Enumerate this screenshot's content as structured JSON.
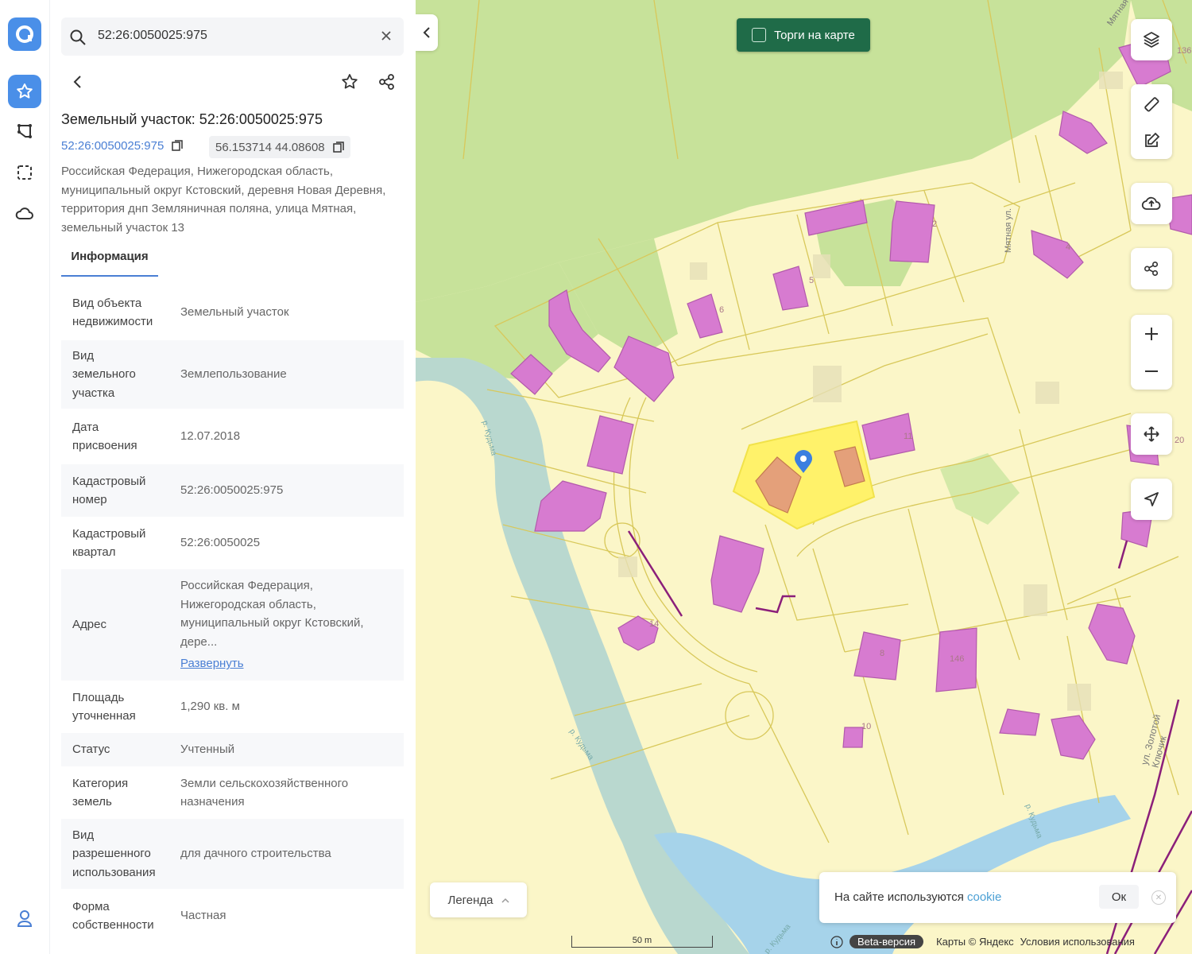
{
  "search": {
    "query": "52:26:0050025:975"
  },
  "panel": {
    "title": "Земельный участок: 52:26:0050025:975",
    "cadastral_link": "52:26:0050025:975",
    "coordinates": "56.153714 44.08608",
    "address": "Российская Федерация, Нижегородская область, муниципальный округ Кстовский, деревня Новая Деревня, территория днп Земляничная поляна, улица Мятная, земельный участок 13",
    "tab_info": "Информация",
    "rows": [
      {
        "label": "Вид объекта недвижимости",
        "value": "Земельный участок"
      },
      {
        "label": "Вид земельного участка",
        "value": "Землепользование"
      },
      {
        "label": "Дата присвоения",
        "value": "12.07.2018"
      },
      {
        "label": "Кадастровый номер",
        "value": "52:26:0050025:975"
      },
      {
        "label": "Кадастровый квартал",
        "value": "52:26:0050025"
      },
      {
        "label": "Адрес",
        "value": "Российская Федерация, Нижегородская область, муниципальный округ Кстовский, дере...",
        "expand": "Развернуть"
      },
      {
        "label": "Площадь уточненная",
        "value": "1,290 кв. м"
      },
      {
        "label": "Статус",
        "value": "Учтенный"
      },
      {
        "label": "Категория земель",
        "value": "Земли сельскохозяйственного назначения"
      },
      {
        "label": "Вид разрешенного использования",
        "value": "для дачного строительства"
      },
      {
        "label": "Форма собственности",
        "value": "Частная"
      }
    ]
  },
  "map": {
    "torgi_label": "Торги на карте",
    "legend_label": "Легенда",
    "cookie_text": "На сайте используются",
    "cookie_link": "cookie",
    "cookie_ok": "Ок",
    "scale_label": "50 m",
    "footer": {
      "beta": "Beta-версия",
      "maps_credit": "Карты © Яндекс",
      "terms": "Условия использования"
    },
    "labels": {
      "street_myatnaya_1": "Мятная ул.",
      "street_myatnaya_2": "Мятная ул.",
      "street_zolotoy": "ул. Золотой Ключик",
      "river_1": "р. Кудьма",
      "river_2": "р. Кудьма",
      "river_3": "р. Кудьма",
      "river_4": "р. Кудьма",
      "n2": "2",
      "n5": "5",
      "n6": "6",
      "n11": "11",
      "n14": "14",
      "n8": "8",
      "n146": "146",
      "n10": "10",
      "n136": "136",
      "n4": "4",
      "n20": "20"
    }
  },
  "colors": {
    "accent": "#4a7fd4",
    "building": "#d77bd0",
    "selected_parcel": "#fff26a",
    "torgi_green": "#1f6b48"
  }
}
